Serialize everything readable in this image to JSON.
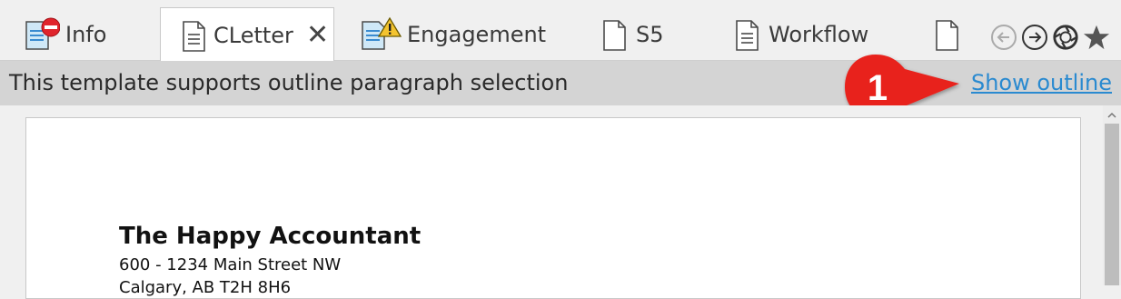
{
  "tabs": [
    {
      "label": "Info",
      "icon": "document-blocked-icon"
    },
    {
      "label": "CLetter",
      "icon": "document-icon",
      "active": true,
      "close": "✕"
    },
    {
      "label": "Engagement",
      "icon": "document-warning-icon"
    },
    {
      "label": "S5",
      "icon": "blank-document-icon"
    },
    {
      "label": "Workflow",
      "icon": "document-icon"
    },
    {
      "label": "",
      "icon": "blank-document-icon"
    }
  ],
  "nav": {
    "back": "back-arrow-icon",
    "forward": "forward-arrow-icon",
    "refresh": "refresh-icon",
    "favorite": "star-icon"
  },
  "infobar": {
    "message": "This template supports outline paragraph selection",
    "link": "Show outline"
  },
  "callout": {
    "number": "1",
    "color": "#e8231f"
  },
  "document": {
    "company": "The Happy Accountant",
    "address_line1": "600 - 1234 Main Street NW",
    "address_line2": "Calgary, AB T2H 8H6"
  },
  "colors": {
    "link": "#2a8ad0",
    "infobar": "#d4d4d4",
    "tab_active": "#ffffff"
  }
}
